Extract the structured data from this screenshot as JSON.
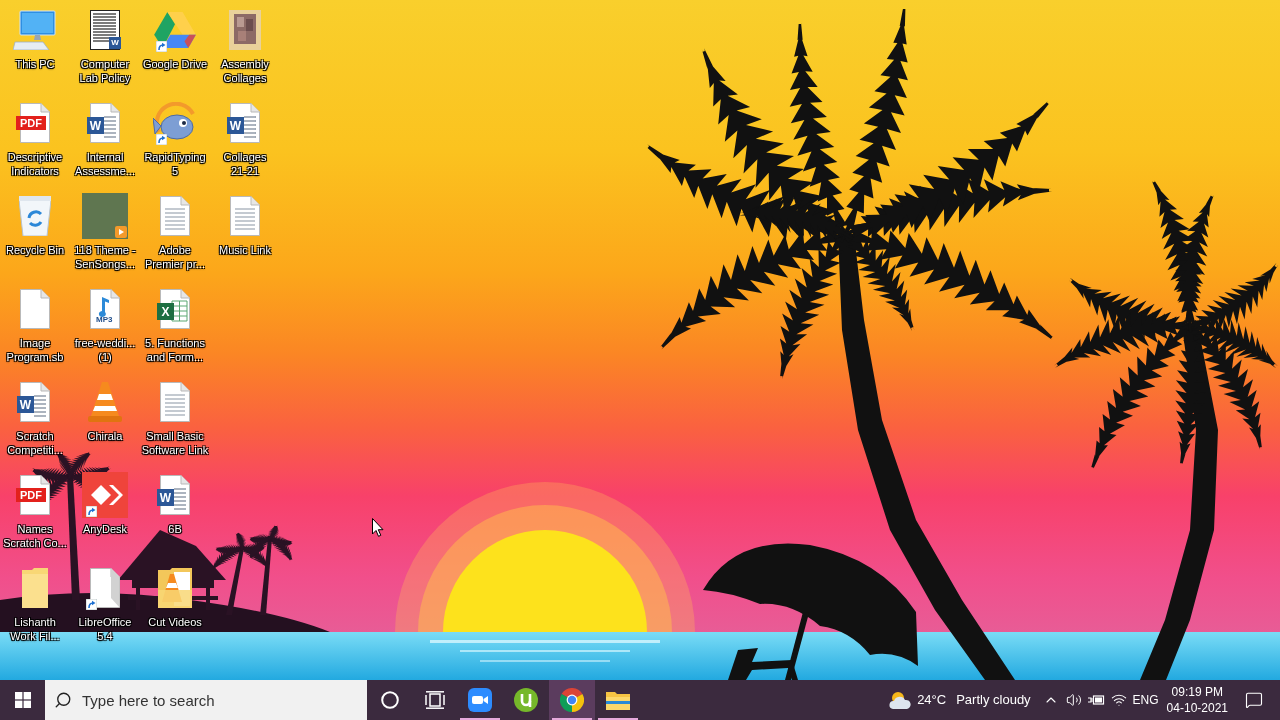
{
  "desktop_icons": [
    {
      "label": "This PC",
      "kind": "pc",
      "shortcut": false
    },
    {
      "label": "Descriptive Indicators",
      "kind": "pdf",
      "badge": "PDF",
      "shortcut": false
    },
    {
      "label": "Recycle Bin",
      "kind": "recycle-bin",
      "shortcut": false
    },
    {
      "label": "Image Program.sb",
      "kind": "blank-file",
      "shortcut": false
    },
    {
      "label": "Scratch Competiti...",
      "kind": "word",
      "badge": "W",
      "shortcut": false
    },
    {
      "label": "Names Scratch Co...",
      "kind": "pdf",
      "badge": "PDF",
      "shortcut": false
    },
    {
      "label": "Lishanth Work Fil...",
      "kind": "folder",
      "shortcut": false
    },
    {
      "label": "Computer Lab Policy",
      "kind": "doc-preview",
      "badge": "W",
      "shortcut": false
    },
    {
      "label": "Internal Assessme...",
      "kind": "word",
      "badge": "W",
      "shortcut": false
    },
    {
      "label": "118 Theme - SenSongs...",
      "kind": "video",
      "shortcut": false
    },
    {
      "label": "free-weddi... (1)",
      "kind": "mp3",
      "badge": "MP3",
      "shortcut": false
    },
    {
      "label": "Chirala",
      "kind": "vlc",
      "shortcut": false
    },
    {
      "label": "AnyDesk",
      "kind": "anydesk",
      "shortcut": true
    },
    {
      "label": "LibreOffice 5.4",
      "kind": "libreoffice",
      "shortcut": true
    },
    {
      "label": "Google Drive",
      "kind": "drive",
      "shortcut": true
    },
    {
      "label": "RapidTyping 5",
      "kind": "fish",
      "shortcut": true
    },
    {
      "label": "Adobe Premier pr...",
      "kind": "text-file",
      "shortcut": false
    },
    {
      "label": "5. Functions and Form...",
      "kind": "excel",
      "badge": "X",
      "shortcut": false
    },
    {
      "label": "Small Basic Software Link",
      "kind": "text-file",
      "shortcut": false
    },
    {
      "label": "6B",
      "kind": "word",
      "badge": "W",
      "shortcut": false
    },
    {
      "label": "Cut Videos",
      "kind": "vlc-folder",
      "shortcut": false
    },
    {
      "label": "Assembly Collages",
      "kind": "image-folder",
      "shortcut": false
    },
    {
      "label": "Collages 21-21",
      "kind": "word",
      "badge": "W",
      "shortcut": false
    },
    {
      "label": "Music Link",
      "kind": "text-file",
      "shortcut": false
    }
  ],
  "taskbar": {
    "search": {
      "placeholder": "Type here to search"
    },
    "buttons": [
      {
        "kind": "cortana"
      },
      {
        "kind": "task-view"
      }
    ],
    "apps": [
      {
        "kind": "zoom",
        "running": true,
        "selected": false
      },
      {
        "kind": "utorrent",
        "running": false,
        "selected": false
      },
      {
        "kind": "chrome",
        "running": true,
        "selected": true
      },
      {
        "kind": "file-explorer",
        "running": true,
        "selected": false
      }
    ],
    "weather": {
      "temperature": "24°C",
      "condition": "Partly cloudy"
    },
    "language": "ENG",
    "clock": {
      "time": "09:19 PM",
      "date": "04-10-2021"
    }
  }
}
